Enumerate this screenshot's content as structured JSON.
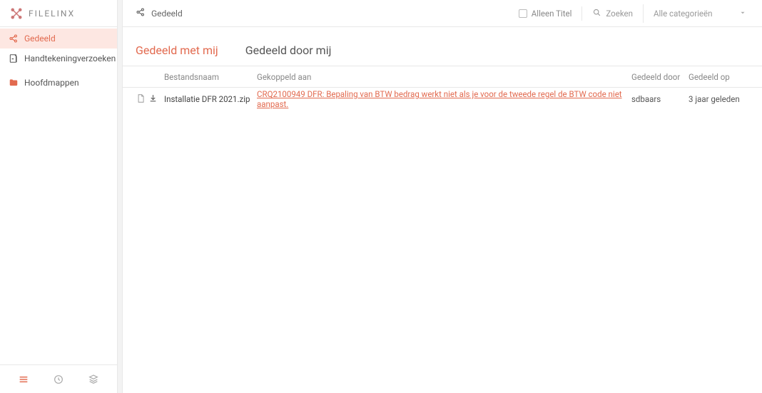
{
  "brand": "FILELINX",
  "sidebar": {
    "items": [
      {
        "label": "Gedeeld"
      },
      {
        "label": "Handtekeningverzoeken"
      },
      {
        "label": "Hoofdmappen"
      }
    ]
  },
  "topbar": {
    "title": "Gedeeld",
    "checkbox_label": "Alleen Titel",
    "search_placeholder": "Zoeken",
    "category_label": "Alle categorieën"
  },
  "tabs": [
    {
      "label": "Gedeeld met mij"
    },
    {
      "label": "Gedeeld door mij"
    }
  ],
  "columns": {
    "name": "Bestandsnaam",
    "linked": "Gekoppeld aan",
    "sharedby": "Gedeeld door",
    "sharedon": "Gedeeld op"
  },
  "rows": [
    {
      "name": "Installatie DFR 2021.zip",
      "linked": "CRQ2100949 DFR: Bepaling van BTW bedrag werkt niet als je voor de tweede regel de BTW code niet aanpast.",
      "sharedby": "sdbaars",
      "sharedon": "3 jaar geleden"
    }
  ]
}
